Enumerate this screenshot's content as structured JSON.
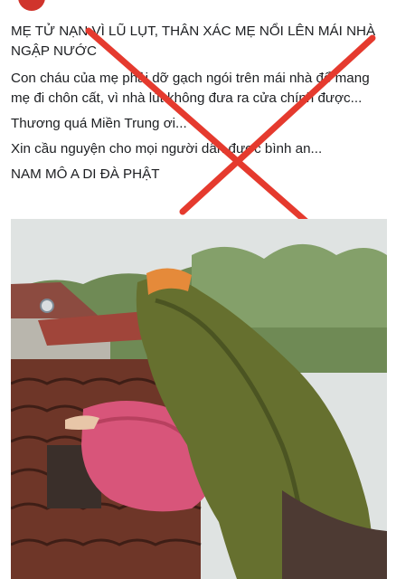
{
  "post": {
    "headline": "MẸ TỬ NẠN VÌ LŨ LỤT, THÂN XÁC MẸ NỔI LÊN MÁI NHÀ NGẬP NƯỚC",
    "paragraph_1": "Con cháu của mẹ phải dỡ gạch ngói trên mái nhà để mang mẹ đi chôn cất, vì nhà lút không đưa ra cửa chính được...",
    "paragraph_2": "Thương quá Miền Trung ơi...",
    "paragraph_3": "Xin cầu nguyện cho mọi người dân được bình an...",
    "paragraph_4": "NAM MÔ A DI ĐÀ PHẬT"
  },
  "overlay": {
    "mark": "red-x-cross",
    "color": "#e53a2e"
  },
  "photo": {
    "subject": "rescue-scene-on-roof",
    "colors": {
      "sky": "#dfe3e2",
      "roof_tile": "#7d3d2c",
      "raincoat": "#66702f",
      "blanket": "#d8557a"
    }
  }
}
